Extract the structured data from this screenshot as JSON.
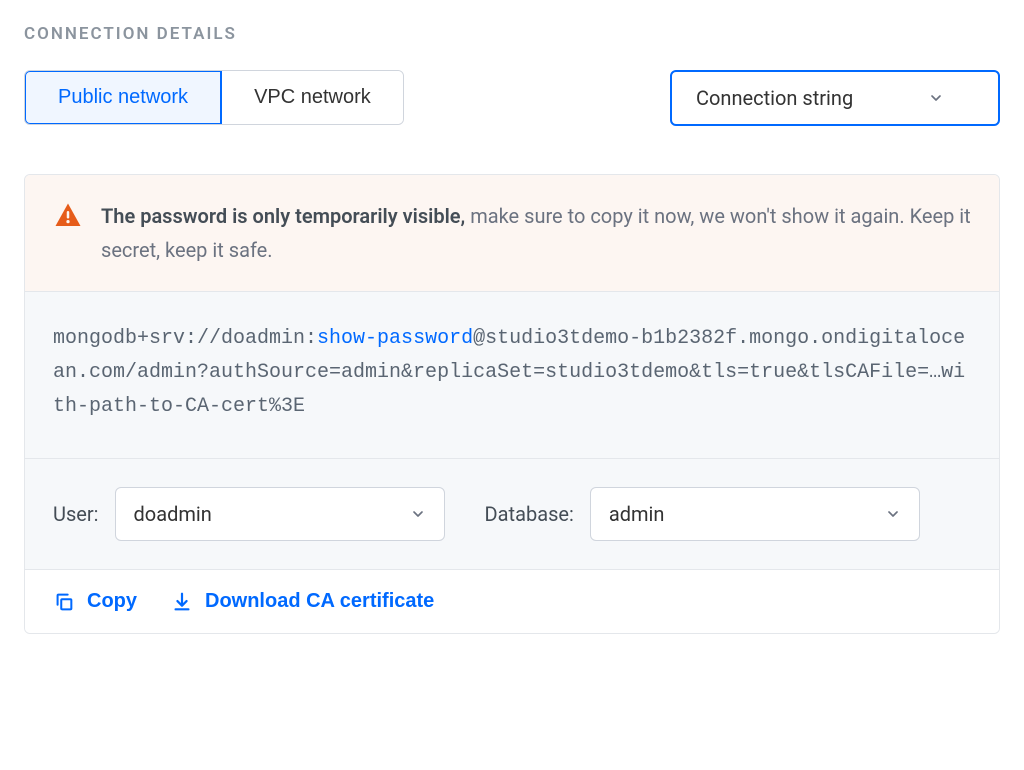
{
  "section_title": "CONNECTION DETAILS",
  "tabs": {
    "public": "Public network",
    "vpc": "VPC network"
  },
  "format_select": {
    "value": "Connection string"
  },
  "warning": {
    "bold": "The password is only temporarily visible,",
    "rest": " make sure to copy it now, we won't show it again. Keep it secret, keep it safe."
  },
  "connection_string": {
    "prefix": "mongodb+srv://doadmin:",
    "show_password": "show-password",
    "suffix": "@studio3tdemo-b1b2382f.mongo.ondigitalocean.com/admin?authSource=admin&replicaSet=studio3tdemo&tls=true&tlsCAFile=…with-path-to-CA-cert%3E"
  },
  "fields": {
    "user_label": "User:",
    "user_value": "doadmin",
    "db_label": "Database:",
    "db_value": "admin"
  },
  "actions": {
    "copy": "Copy",
    "download": "Download CA certificate"
  }
}
